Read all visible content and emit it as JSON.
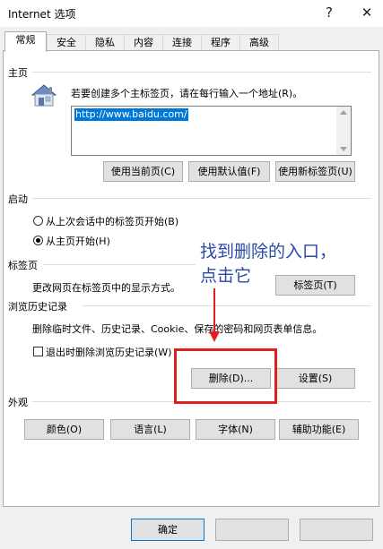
{
  "window": {
    "title": "Internet 选项",
    "help_glyph": "?",
    "close_glyph": "✕"
  },
  "tabs": [
    {
      "label": "常规",
      "active": true
    },
    {
      "label": "安全"
    },
    {
      "label": "隐私"
    },
    {
      "label": "内容"
    },
    {
      "label": "连接"
    },
    {
      "label": "程序"
    },
    {
      "label": "高级"
    }
  ],
  "home": {
    "section_title": "主页",
    "description": "若要创建多个主标签页，请在每行输入一个地址(R)。",
    "url": "http://www.baidu.com/",
    "buttons": [
      "使用当前页(C)",
      "使用默认值(F)",
      "使用新标签页(U)"
    ],
    "icon": "house-icon"
  },
  "startup": {
    "section_title": "启动",
    "options": [
      {
        "label": "从上次会话中的标签页开始(B)",
        "selected": false
      },
      {
        "label": "从主页开始(H)",
        "selected": true
      }
    ]
  },
  "tabs_section": {
    "section_title": "标签页",
    "description": "更改网页在标签页中的显示方式。",
    "button": "标签页(T)"
  },
  "history": {
    "section_title": "浏览历史记录",
    "description": "删除临时文件、历史记录、Cookie、保存的密码和网页表单信息。",
    "checkbox_label": "退出时删除浏览历史记录(W)",
    "delete_button": "删除(D)...",
    "settings_button": "设置(S)"
  },
  "appearance": {
    "section_title": "外观",
    "buttons": [
      "颜色(O)",
      "语言(L)",
      "字体(N)",
      "辅助功能(E)"
    ]
  },
  "footer": {
    "ok_button": "确定"
  },
  "annotation": {
    "line1": "找到删除的入口，",
    "line2": "点击它",
    "color": "#2b49a6",
    "box_color": "#e02020"
  }
}
